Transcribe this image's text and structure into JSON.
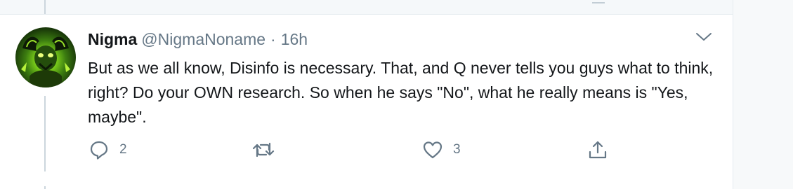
{
  "tweet": {
    "display_name": "Nigma",
    "handle": "@NigmaNoname",
    "separator": "·",
    "time": "16h",
    "text": "But as we all know, Disinfo is necessary. That, and Q never tells you guys what to think, right? Do your OWN research. So when he says \"No\", what he really means is \"Yes, maybe\".",
    "avatar_icon": "horned-creature-avatar",
    "more_icon": "chevron-down-icon"
  },
  "actions": {
    "reply": {
      "icon": "reply-icon",
      "count": "2"
    },
    "retweet": {
      "icon": "retweet-icon",
      "count": ""
    },
    "like": {
      "icon": "heart-icon",
      "count": "3"
    },
    "share": {
      "icon": "share-icon"
    }
  },
  "colors": {
    "text": "#14171a",
    "secondary": "#657786",
    "thread_line": "#ccd6dd",
    "background": "#ffffff"
  }
}
